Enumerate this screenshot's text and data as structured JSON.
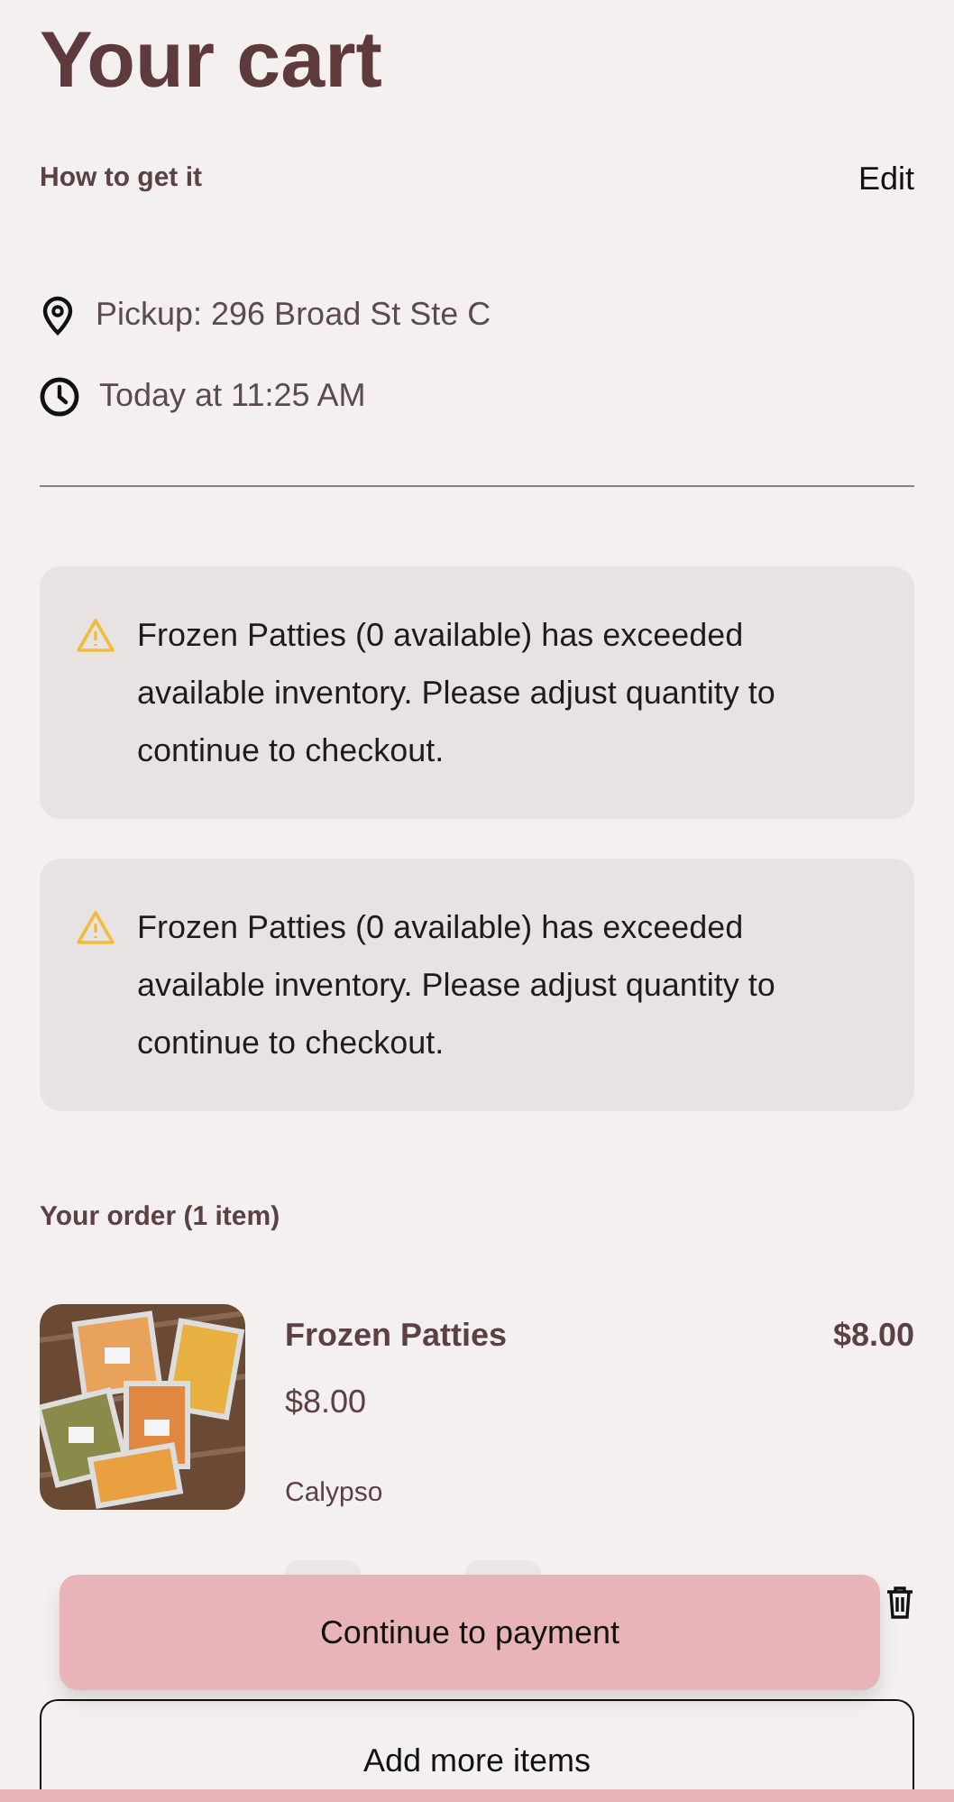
{
  "title": "Your cart",
  "fulfillment": {
    "heading": "How to get it",
    "edit_link": "Edit",
    "details": [
      {
        "kind": "location",
        "text": "Pickup: 296 Broad St Ste C"
      },
      {
        "kind": "time",
        "text": "Today at 11:25 AM"
      }
    ]
  },
  "alerts": [
    {
      "message": "Frozen Patties (0 available) has exceeded available inventory. Please adjust quantity to continue to checkout."
    },
    {
      "message": "Frozen Patties (0 available) has exceeded available inventory. Please adjust quantity to continue to checkout."
    }
  ],
  "order": {
    "heading": "Your order (1 item)",
    "items": [
      {
        "name": "Frozen Patties",
        "total": "$8.00",
        "price": "$8.00",
        "variant": "Calypso"
      }
    ]
  },
  "primary_button": "Continue to payment",
  "secondary_button": "Add more items"
}
